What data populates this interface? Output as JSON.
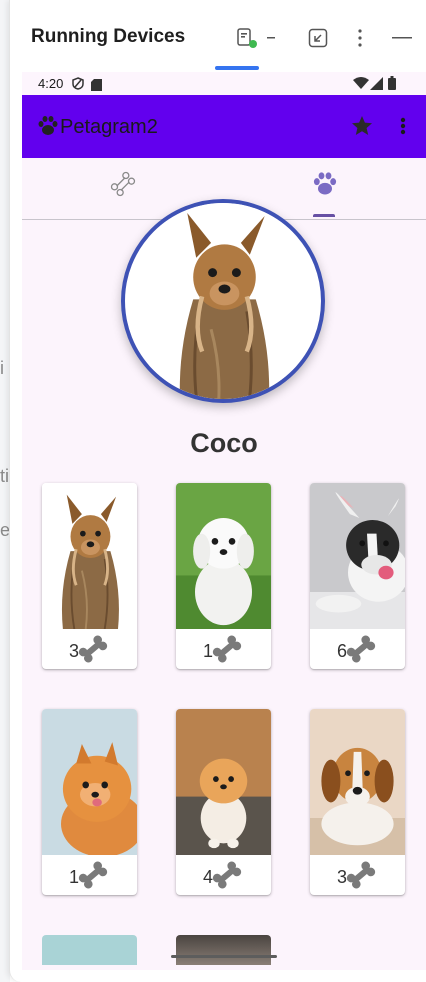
{
  "background_app": {
    "chars": [
      "i",
      "ti",
      "e"
    ]
  },
  "toolbar": {
    "title": "Running Devices",
    "icons": [
      "device-mirror-icon",
      "minus-icon",
      "collapse-icon",
      "more-vert-icon",
      "minimize-icon"
    ]
  },
  "status_bar": {
    "time": "4:20",
    "icons": [
      "shield-icon",
      "sd-card-icon",
      "wifi-icon",
      "signal-icon",
      "battery-icon"
    ]
  },
  "app_bar": {
    "title": "Petagram2",
    "color": "#6200ee",
    "icons": [
      "paw-icon",
      "star-icon",
      "more-vert-icon"
    ]
  },
  "tabs": [
    {
      "icon": "bone-icon",
      "selected": false
    },
    {
      "icon": "paw-icon",
      "selected": true
    }
  ],
  "profile": {
    "name": "Coco",
    "avatar": "yorkshire-terrier"
  },
  "grid": [
    {
      "breed": "yorkshire-terrier",
      "likes": "3"
    },
    {
      "breed": "maltese",
      "likes": "1"
    },
    {
      "breed": "french-bulldog",
      "likes": "6"
    },
    {
      "breed": "pomeranian",
      "likes": "1"
    },
    {
      "breed": "pomeranian-boo",
      "likes": "4"
    },
    {
      "breed": "beagle",
      "likes": "3"
    }
  ],
  "colors": {
    "accent": "#6200ee",
    "avatar_border": "#3e52b5",
    "tab_indicator": "#6750a4",
    "bone": "#7a7a7a"
  }
}
